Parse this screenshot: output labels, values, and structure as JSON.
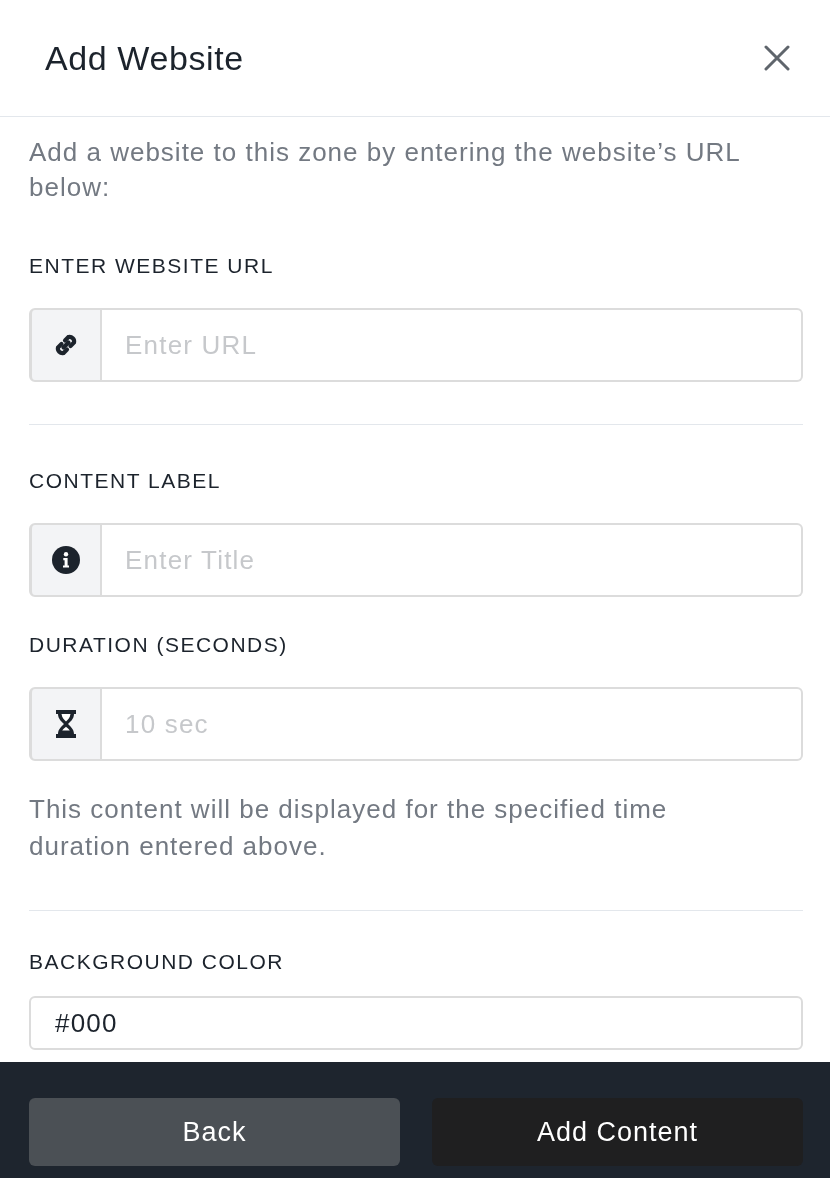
{
  "dialog": {
    "title": "Add Website"
  },
  "intro": "Add a website to this zone by entering the website’s URL below:",
  "sections": [
    {
      "fields": [
        {
          "kind": "url",
          "label": "ENTER WEBSITE URL",
          "placeholder": "Enter URL"
        }
      ]
    },
    {
      "fields": [
        {
          "kind": "title",
          "label": "CONTENT LABEL",
          "placeholder": "Enter Title"
        },
        {
          "kind": "duration",
          "label": "DURATION (SECONDS)",
          "placeholder": "10 sec"
        }
      ],
      "help": "This content will be displayed for the specified time duration entered above."
    },
    {
      "fields": [
        {
          "kind": "color",
          "label": "BACKGROUND COLOR",
          "value": "#000"
        }
      ]
    }
  ],
  "footer": {
    "buttons": [
      {
        "kind": "secondary",
        "label": "Back"
      },
      {
        "kind": "primary",
        "label": "Add Content"
      }
    ]
  }
}
